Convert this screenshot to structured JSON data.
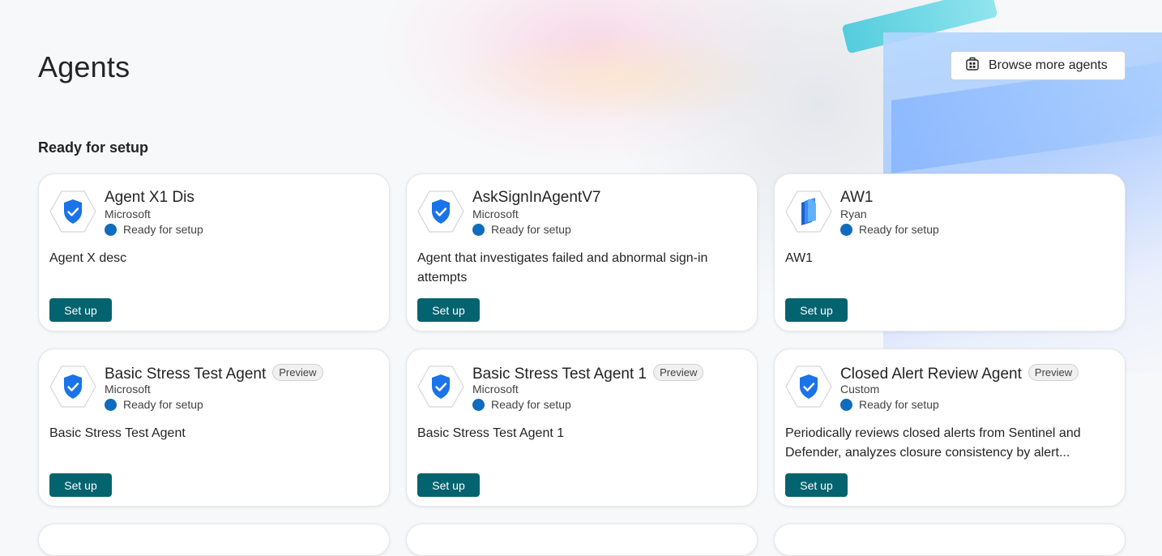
{
  "header": {
    "title": "Agents",
    "browse_label": "Browse more agents"
  },
  "section": {
    "title": "Ready for setup"
  },
  "cards": [
    {
      "name": "Agent X1 Dis",
      "publisher": "Microsoft",
      "status": "Ready for setup",
      "description": "Agent X desc",
      "action": "Set up",
      "icon": "shield-check-icon"
    },
    {
      "name": "AskSignInAgentV7",
      "publisher": "Microsoft",
      "status": "Ready for setup",
      "description": "Agent that investigates failed and abnormal sign-in attempts",
      "action": "Set up",
      "icon": "shield-check-icon"
    },
    {
      "name": "AW1",
      "publisher": "Ryan",
      "status": "Ready for setup",
      "description": "AW1",
      "action": "Set up",
      "icon": "agent-book-icon"
    },
    {
      "name": "Basic Stress Test Agent",
      "badge": "Preview",
      "publisher": "Microsoft",
      "status": "Ready for setup",
      "description": "Basic Stress Test Agent",
      "action": "Set up",
      "icon": "shield-check-icon"
    },
    {
      "name": "Basic Stress Test Agent 1",
      "badge": "Preview",
      "publisher": "Microsoft",
      "status": "Ready for setup",
      "description": "Basic Stress Test Agent 1",
      "action": "Set up",
      "icon": "shield-check-icon"
    },
    {
      "name": "Closed Alert Review Agent",
      "badge": "Preview",
      "publisher": "Custom",
      "status": "Ready for setup",
      "description": "Periodically reviews closed alerts from Sentinel and Defender, analyzes closure consistency by alert...",
      "action": "Set up",
      "icon": "shield-check-icon"
    }
  ],
  "colors": {
    "primary_button": "#03636e",
    "status_dot": "#0f6cbd",
    "shield": "#1a73e8"
  }
}
